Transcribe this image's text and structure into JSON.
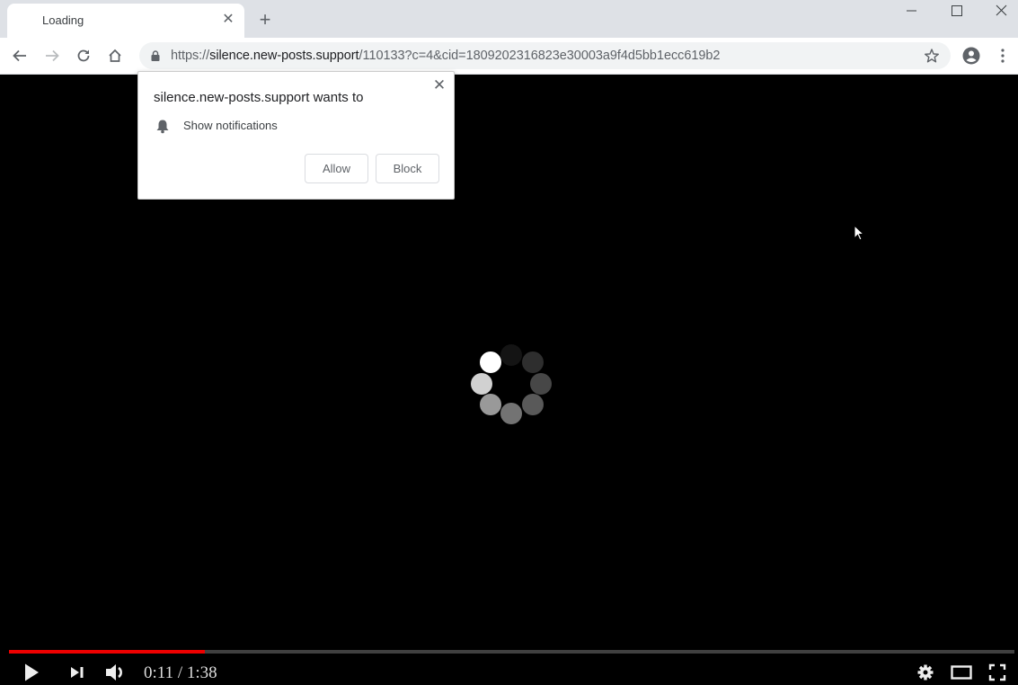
{
  "browser": {
    "tab": {
      "title": "Loading",
      "close_icon": "close-icon"
    },
    "new_tab_icon": "plus-icon",
    "window_controls": {
      "minimize": "minimize-icon",
      "maximize": "maximize-icon",
      "close": "close-icon"
    },
    "toolbar": {
      "back": "arrow-left-icon",
      "forward": "arrow-right-icon",
      "reload": "reload-icon",
      "home": "home-icon",
      "url": {
        "scheme": "https://",
        "host": "silence.new-posts.support",
        "path": "/110133?c=4&cid=1809202316823e30003a9f4d5bb1ecc619b2"
      },
      "bookmark": "star-icon",
      "profile": "account-icon",
      "menu": "more-vert-icon"
    }
  },
  "permission_popup": {
    "title": "silence.new-posts.support wants to",
    "permission": "Show notifications",
    "permission_icon": "bell-icon",
    "allow_label": "Allow",
    "block_label": "Block"
  },
  "player": {
    "state": "loading",
    "current_time": "0:11",
    "separator": " / ",
    "duration": "1:38",
    "time_display": "0:11 / 1:38",
    "progress_fraction": 0.195,
    "accent_color": "#ee0000",
    "controls": [
      "play-icon",
      "next-icon",
      "volume-icon",
      "settings-icon",
      "theater-icon",
      "fullscreen-icon"
    ],
    "spinner_dot_opacities": [
      0.08,
      0.18,
      0.28,
      0.35,
      0.45,
      0.6,
      0.82,
      1.0
    ]
  }
}
